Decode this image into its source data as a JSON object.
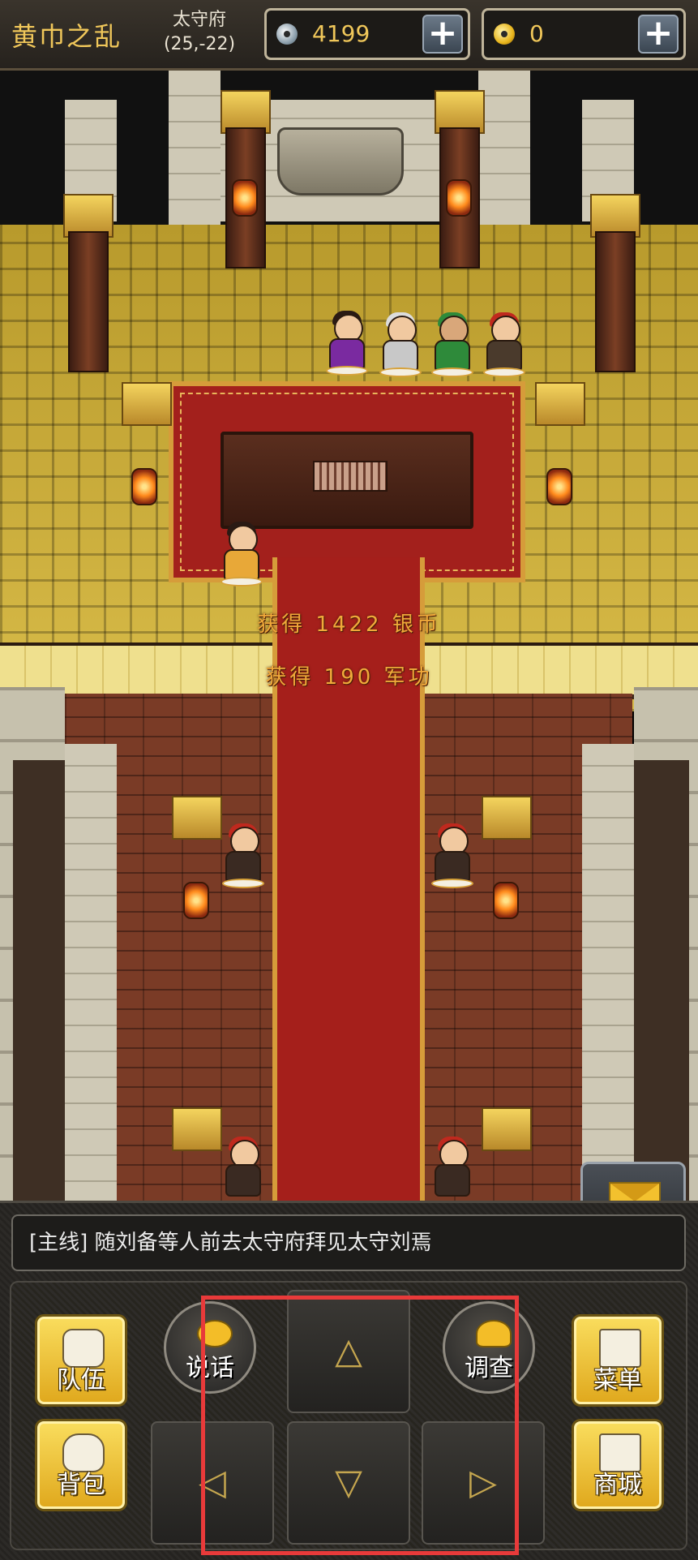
{
  "topbar": {
    "chapter": "黄巾之乱",
    "location_name": "太守府",
    "location_coords": "(25,-22)",
    "silver": "4199",
    "gold": "0",
    "add_silver": "+",
    "add_gold": "+"
  },
  "map": {
    "rewards": [
      "获得 1422 银币",
      "获得 190 军功"
    ],
    "mail_label": "邮件"
  },
  "quest": {
    "text": "[主线] 随刘备等人前去太守府拜见太守刘焉"
  },
  "controls": {
    "team": "队伍",
    "bag": "背包",
    "talk": "说话",
    "investigate": "调查",
    "menu": "菜单",
    "shop": "商城",
    "up": "△",
    "down": "▽",
    "left": "◁",
    "right": "▷"
  },
  "colors": {
    "accent_gold": "#f0c75a",
    "reward_text": "#f0a93a",
    "highlight_box": "#e83a3a"
  }
}
